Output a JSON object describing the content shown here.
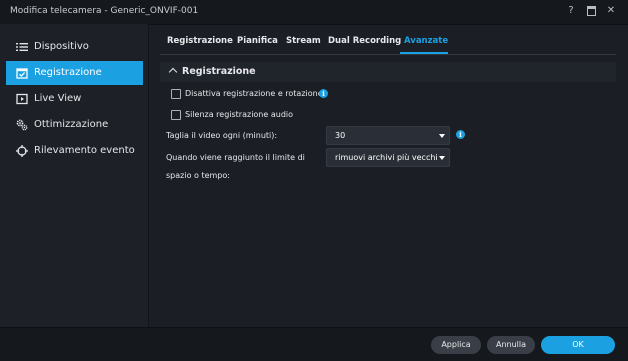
{
  "window": {
    "title": "Modifica telecamera - Generic_ONVIF-001",
    "help_label": "?",
    "close_label": "✕"
  },
  "sidebar": {
    "items": [
      {
        "label": "Dispositivo",
        "icon": "list-icon"
      },
      {
        "label": "Registrazione",
        "icon": "calendar-check-icon",
        "active": true
      },
      {
        "label": "Live View",
        "icon": "play-square-icon"
      },
      {
        "label": "Ottimizzazione",
        "icon": "gears-icon"
      },
      {
        "label": "Rilevamento evento",
        "icon": "crosshair-icon"
      }
    ]
  },
  "tabs": [
    "Registrazione",
    "Pianifica",
    "Stream",
    "Dual Recording",
    "Avanzate"
  ],
  "active_tab": "Avanzate",
  "section": {
    "title": "Registrazione",
    "checkbox_disable": "Disattiva registrazione e rotazione",
    "checkbox_audio": "Silenza registrazione audio",
    "info_glyph": "i",
    "split_label": "Taglia il video ogni (minuti):",
    "split_value": "30",
    "limit_label_line1": "Quando viene raggiunto il limite di",
    "limit_label_line2": "spazio o tempo:",
    "limit_value": "rimuovi archivi più vecchi"
  },
  "footer": {
    "apply": "Applica",
    "cancel": "Annulla",
    "ok": "OK"
  },
  "colors": {
    "accent": "#1ba1e2",
    "background": "#1b1f25"
  }
}
